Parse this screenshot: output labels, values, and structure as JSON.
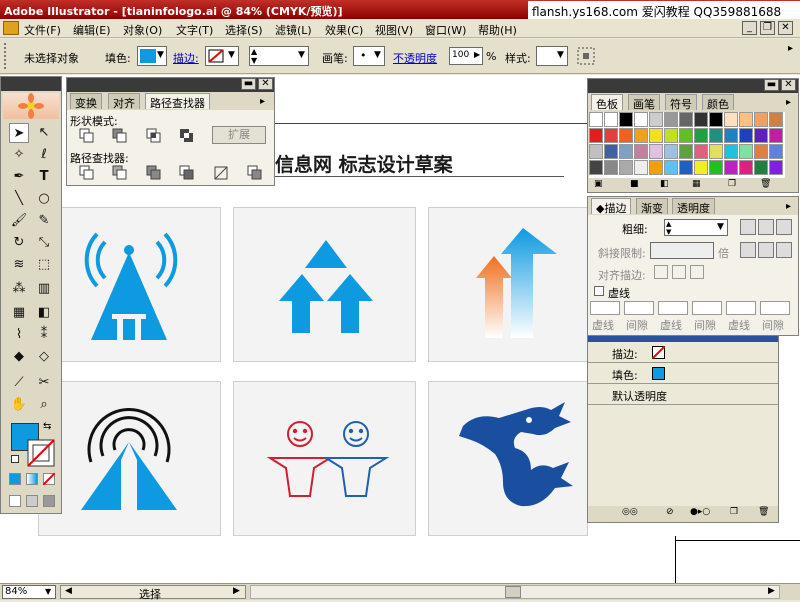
{
  "titlebar": {
    "title": "Adobe Illustrator - [tianinfologo.ai @ 84% (CMYK/预览)]",
    "watermark": "flansh.ys168.com 爱闪教程 QQ359881688"
  },
  "menu": {
    "items": [
      "文件(F)",
      "编辑(E)",
      "对象(O)",
      "文字(T)",
      "选择(S)",
      "滤镜(L)",
      "效果(C)",
      "视图(V)",
      "窗口(W)",
      "帮助(H)"
    ]
  },
  "control": {
    "status": "未选择对象",
    "fill_label": "填色:",
    "stroke_label": "描边:",
    "brush_label": "画笔:",
    "opacity_label": "不透明度",
    "opacity_value": "100",
    "percent": "%",
    "style_label": "样式:"
  },
  "pathfinder": {
    "tabs": [
      "变换",
      "对齐",
      "路径查找器"
    ],
    "shape_modes_label": "形状模式:",
    "expand_label": "扩展",
    "pathfinders_label": "路径查找器:"
  },
  "canvas": {
    "title": "信息网 标志设计草案"
  },
  "swatches": {
    "tabs": [
      "色板",
      "画笔",
      "符号",
      "颜色"
    ]
  },
  "stroke_panel": {
    "tabs": [
      "描边",
      "渐变",
      "透明度"
    ],
    "weight_label": "粗细:",
    "miter_label": "斜接限制:",
    "miter_unit": "倍",
    "align_label": "对齐描边:",
    "dashed_label": "虚线",
    "dash_labels": [
      "虚线",
      "间隙",
      "虚线",
      "间隙",
      "虚线",
      "间隙"
    ]
  },
  "appearance": {
    "rows": [
      "描边:",
      "填色:",
      "默认透明度"
    ]
  },
  "status": {
    "zoom": "84%",
    "mode": "选择"
  },
  "colors": {
    "accent_blue": "#0d9ae0",
    "title_red": "#a00000",
    "orange": "#f07020",
    "dragon_blue": "#1a4fa0",
    "figure_red": "#d02030",
    "figure_blue": "#2060b0"
  }
}
